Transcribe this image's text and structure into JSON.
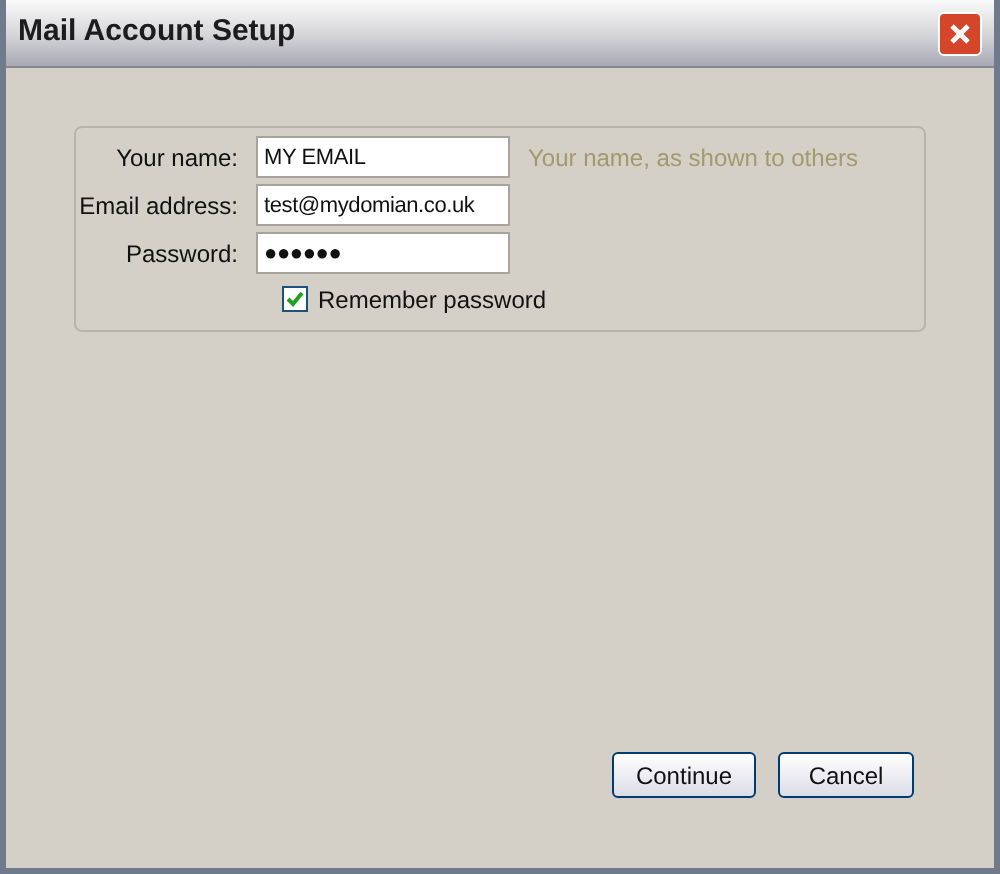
{
  "window": {
    "title": "Mail Account Setup"
  },
  "fields": [
    {
      "label": "Your name:",
      "value": "MY EMAIL",
      "hint": "Your name, as shown to others"
    },
    {
      "label": "Email address:",
      "value": "test@mydomian.co.uk"
    },
    {
      "label": "Password:",
      "value": "●●●●●●"
    }
  ],
  "remember_password": {
    "label": "Remember password",
    "checked": true
  },
  "buttons": [
    "Continue",
    "Cancel"
  ]
}
